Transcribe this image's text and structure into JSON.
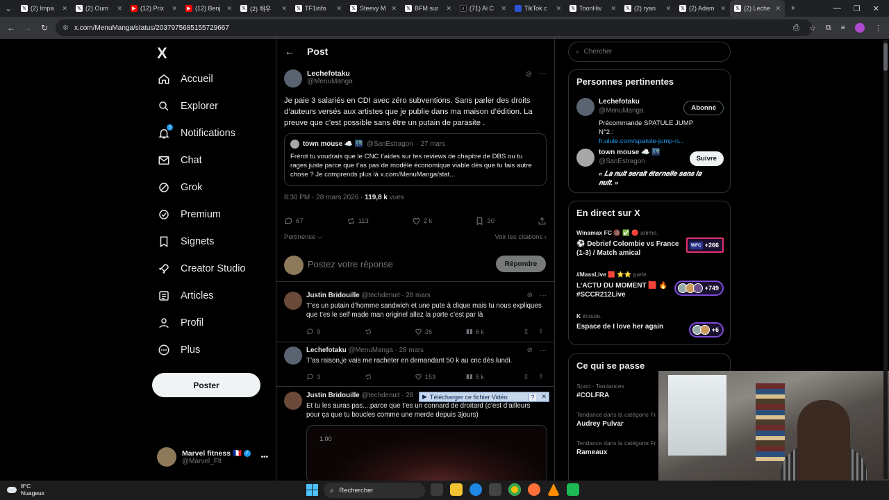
{
  "browser": {
    "tabs": [
      {
        "title": "(2) Impa",
        "icon": "x-logo-icon"
      },
      {
        "title": "(2) Oum",
        "icon": "x-logo-icon"
      },
      {
        "title": "(12) Prix",
        "icon": "youtube-icon"
      },
      {
        "title": "(12) Benj",
        "icon": "youtube-icon"
      },
      {
        "title": "(2) 채우",
        "icon": "x-logo-icon"
      },
      {
        "title": "TF1info",
        "icon": "x-logo-icon"
      },
      {
        "title": "Steevy M",
        "icon": "x-logo-icon"
      },
      {
        "title": "BFM sur",
        "icon": "x-logo-icon"
      },
      {
        "title": "(71) Ai C",
        "icon": "tiktok-icon"
      },
      {
        "title": "TikTok c",
        "icon": "site-icon"
      },
      {
        "title": "ToonHiv",
        "icon": "x-logo-icon"
      },
      {
        "title": "(2) ryan",
        "icon": "x-logo-icon"
      },
      {
        "title": "(2) Adam",
        "icon": "x-logo-icon"
      },
      {
        "title": "(2) Leche",
        "icon": "x-logo-icon"
      }
    ],
    "url": "x.com/MenuManga/status/2037975685155729667"
  },
  "nav": {
    "logo": "X",
    "items": [
      {
        "label": "Accueil",
        "icon": "home-icon"
      },
      {
        "label": "Explorer",
        "icon": "search-icon"
      },
      {
        "label": "Notifications",
        "icon": "bell-icon",
        "badge": "2"
      },
      {
        "label": "Chat",
        "icon": "mail-icon"
      },
      {
        "label": "Grok",
        "icon": "grok-icon"
      },
      {
        "label": "Premium",
        "icon": "premium-icon"
      },
      {
        "label": "Signets",
        "icon": "bookmark-icon"
      },
      {
        "label": "Creator Studio",
        "icon": "rocket-icon"
      },
      {
        "label": "Articles",
        "icon": "article-icon"
      },
      {
        "label": "Profil",
        "icon": "person-icon"
      },
      {
        "label": "Plus",
        "icon": "more-circle-icon"
      }
    ],
    "post_button": "Poster",
    "account": {
      "name": "Marvel fitness",
      "flag": "🇫🇷",
      "handle": "@Marvel_Flt",
      "more": "•••"
    }
  },
  "main": {
    "back": "←",
    "header_title": "Post",
    "tweet": {
      "name": "Lechefotaku",
      "handle": "@MenuManga",
      "text": "Je paie 3 salariés en CDI avec zéro subventions. Sans parler des droits d’auteurs versés aux artistes que je publie dans ma maison d’édition. La preuve que c’est possible sans être un putain de parasite .",
      "quote": {
        "name": "town mouse ☁️ 🌃",
        "handle": "@SanEstragon",
        "date": "· 27 mars",
        "text": "Frérot tu voudrais que le CNC t’aides sur tes reviews de chapitre de DBS ou tu rages juste parce que t’as pas de modèle économique viable dès que tu fais autre chose ? Je comprends plus là x.com/MenuManga/stat..."
      },
      "meta_time": "8:30 PM · 28 mars 2026 · ",
      "meta_views": "119,8 k",
      "meta_views_label": " vues",
      "stats": {
        "replies": "67",
        "reposts": "113",
        "likes": "2 k",
        "bookmarks": "30"
      },
      "sort_label": "Pertinence ⌵",
      "quotes_link": "Voir les citations ›"
    },
    "reply_placeholder": "Postez votre réponse",
    "reply_button": "Répondre",
    "replies": [
      {
        "name": "Justin Bridouille",
        "handle": "@techdenuit",
        "date": "· 28 mars",
        "text": "T’es un putain d’homme sandwich et une pute à clique mais tu nous expliques que t’es le self made man originel allez la porte c’est par là",
        "stats": {
          "replies": "9",
          "reposts": "",
          "likes": "26",
          "views": "6 k"
        }
      },
      {
        "name": "Lechefotaku",
        "handle": "@MenuManga",
        "date": "· 28 mars",
        "text": "T’as raison,je vais me racheter en demandant 50 k au cnc dès lundi.",
        "stats": {
          "replies": "3",
          "reposts": "",
          "likes": "153",
          "views": "5 k"
        }
      },
      {
        "name": "Justin Bridouille",
        "handle": "@techdenuit",
        "date": "· 28",
        "text": "Et tu les auras pas....parce que t’es un connard de droitard (c’est d’ailleurs pour ça que tu boucles comme une merde depuis 3jours)"
      }
    ],
    "download_bar": {
      "label": "Télécharger ce fichier Vidéo",
      "help": "?",
      "close": "✕"
    },
    "video_time": "1.00"
  },
  "right": {
    "search_placeholder": "Chercher",
    "relevant_title": "Personnes pertinentes",
    "people": [
      {
        "name": "Lechefotaku",
        "handle": "@MenuManga",
        "button": "Abonné",
        "bio": "Précommande SPATULE JUMP N°2 :",
        "link": "fr.ulule.com/spatule-jump-n..."
      },
      {
        "name": "town mouse ☁️ 🌃",
        "handle": "@SanEstragon",
        "button": "Suivre",
        "bio": "« 𝑳𝒂 𝒏𝒖𝒊𝒕 𝒔𝒆𝒓𝒂𝒊𝒕 𝒆́𝒕𝒆𝒓𝒏𝒆𝒍𝒍𝒆 𝒔𝒂𝒏𝒔 𝒍𝒂 𝒏𝒖𝒊𝒕. »"
      }
    ],
    "live_title": "En direct sur X",
    "live": [
      {
        "host": "Winamax FC",
        "host_suffix": "🔞 ✅ 🔴 anime.",
        "title": "⚽ Debrief Colombie vs France (1-3) / Match amical",
        "pill_label": "WFC",
        "count": "+266"
      },
      {
        "host": "#MassLive",
        "host_suffix": "🟥 ⭐⭐ parle.",
        "title": "L’ACTU DU MOMENT 🟥 🔥 #SCCR212Live",
        "count": "+749"
      },
      {
        "host": "K",
        "host_suffix": "écoute.",
        "title": "Espace de I love her again",
        "count": "+6"
      }
    ],
    "trends_title": "Ce qui se passe",
    "trends": [
      {
        "context": "Sport · Tendances",
        "name": "#COLFRA"
      },
      {
        "context": "Tendance dans la catégorie Fr",
        "name": "Audrey Pulvar"
      },
      {
        "context": "Tendance dans la catégorie Fr",
        "name": "Rameaux"
      }
    ]
  },
  "taskbar": {
    "temp": "8°C",
    "weather": "Nuageux",
    "search": "Rechercher"
  }
}
